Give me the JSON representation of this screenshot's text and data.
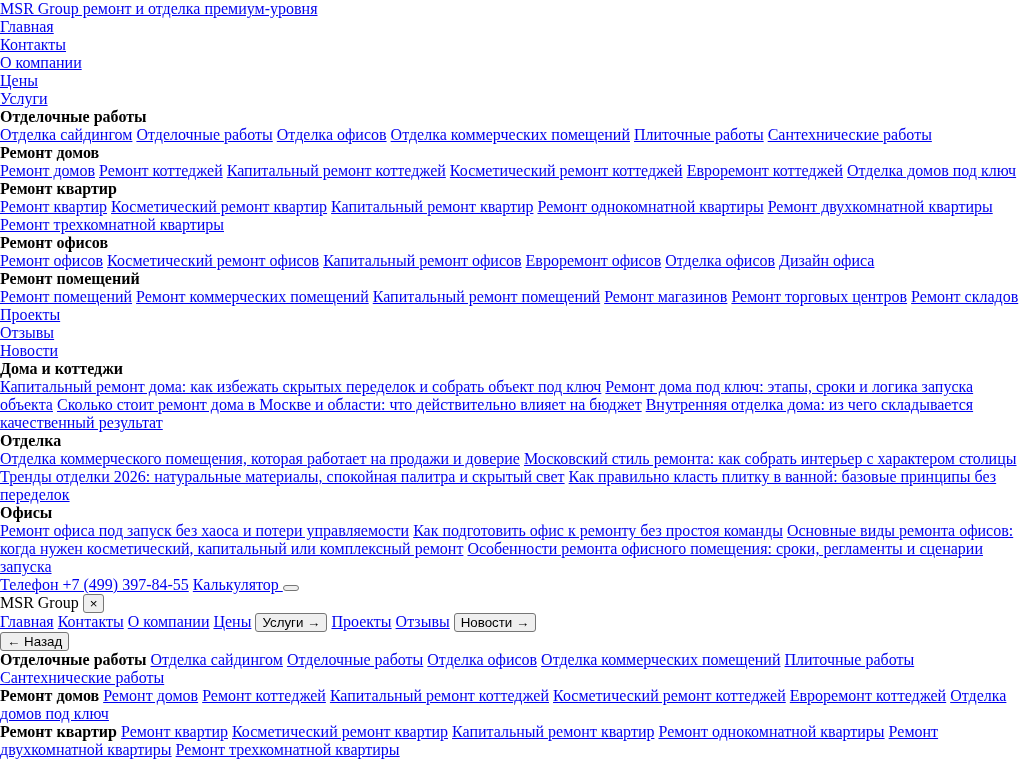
{
  "brand": "MSR Group ремонт и отделка премиум-уровня",
  "menu": [
    {
      "kind": "link",
      "label": "Главная"
    },
    {
      "kind": "link",
      "label": "Контакты"
    },
    {
      "kind": "link",
      "label": "О компании"
    },
    {
      "kind": "link",
      "label": "Цены"
    },
    {
      "kind": "link",
      "label": "Услуги"
    },
    {
      "kind": "group",
      "heading": "Отделочные работы",
      "links": [
        "Отделка сайдингом",
        "Отделочные работы",
        "Отделка офисов",
        "Отделка коммерческих помещений",
        "Плиточные работы",
        "Сантехнические работы"
      ]
    },
    {
      "kind": "group",
      "heading": "Ремонт домов",
      "links": [
        "Ремонт домов",
        "Ремонт коттеджей",
        "Капитальный ремонт коттеджей",
        "Косметический ремонт коттеджей",
        "Евроремонт коттеджей",
        "Отделка домов под ключ"
      ]
    },
    {
      "kind": "group",
      "heading": "Ремонт квартир",
      "links": [
        "Ремонт квартир",
        "Косметический ремонт квартир",
        "Капитальный ремонт квартир",
        "Ремонт однокомнатной квартиры",
        "Ремонт двухкомнатной квартиры",
        "Ремонт трехкомнатной квартиры"
      ]
    },
    {
      "kind": "group",
      "heading": "Ремонт офисов",
      "links": [
        "Ремонт офисов",
        "Косметический ремонт офисов",
        "Капитальный ремонт офисов",
        "Евроремонт офисов",
        "Отделка офисов",
        "Дизайн офиса"
      ]
    },
    {
      "kind": "group",
      "heading": "Ремонт помещений",
      "links": [
        "Ремонт помещений",
        "Ремонт коммерческих помещений",
        "Капитальный ремонт помещений",
        "Ремонт магазинов",
        "Ремонт торговых центров",
        "Ремонт складов"
      ]
    },
    {
      "kind": "link",
      "label": "Проекты"
    },
    {
      "kind": "link",
      "label": "Отзывы"
    },
    {
      "kind": "link",
      "label": "Новости"
    },
    {
      "kind": "group",
      "heading": "Дома и коттеджи",
      "links": [
        "Капитальный ремонт дома: как избежать скрытых переделок и собрать объект под ключ",
        [
          "Ремонт дома под ключ: этапы, сроки и логика запуска",
          "объекта"
        ],
        "Сколько стоит ремонт дома в Москве и области: что действительно влияет на бюджет",
        [
          "Внутренняя отделка дома: из чего складывается",
          "качественный результат"
        ]
      ]
    },
    {
      "kind": "group",
      "heading": "Отделка",
      "links": [
        "Отделка коммерческого помещения, которая работает на продажи и доверие",
        "Московский стиль ремонта: как собрать интерьер с характером столицы",
        "Тренды отделки 2026: натуральные материалы, спокойная палитра и скрытый свет",
        [
          "Как правильно класть плитку в ванной: базовые принципы без",
          "переделок"
        ]
      ]
    },
    {
      "kind": "group",
      "heading": "Офисы",
      "links": [
        "Ремонт офиса под запуск без хаоса и потери управляемости",
        "Как подготовить офис к ремонту без простоя команды",
        [
          "Основные виды ремонта офисов:",
          "когда нужен косметический, капитальный или комплексный ремонт"
        ],
        [
          "Особенности ремонта офисного помещения: сроки, регламенты и сценарии",
          "запуска"
        ]
      ]
    }
  ],
  "contacts": [
    "Телефон +7 (499) 397-84-55",
    "Калькулятор "
  ],
  "menu_open": true,
  "mobile_menu": {
    "title": "MSR Group",
    "close": "×",
    "nav": [
      {
        "kind": "link",
        "label": "Главная"
      },
      {
        "kind": "link",
        "label": "Контакты"
      },
      {
        "kind": "link",
        "label": "О компании"
      },
      {
        "kind": "link",
        "label": "Цены"
      },
      {
        "kind": "button",
        "label": "Услуги →"
      },
      {
        "kind": "link",
        "label": "Проекты"
      },
      {
        "kind": "link",
        "label": "Отзывы"
      },
      {
        "kind": "button",
        "label": "Новости →"
      }
    ],
    "back": "← Назад",
    "groups": [
      {
        "heading": "Отделочные работы",
        "links": [
          "Отделка сайдингом",
          "Отделочные работы",
          "Отделка офисов",
          "Отделка коммерческих помещений",
          "Плиточные работы",
          "Сантехнические работы"
        ]
      },
      {
        "heading": "Ремонт домов",
        "links": [
          "Ремонт домов",
          "Ремонт коттеджей",
          "Капитальный ремонт коттеджей",
          "Косметический ремонт коттеджей",
          "Евроремонт коттеджей",
          [
            "Отделка",
            "домов под ключ"
          ]
        ]
      },
      {
        "heading": "Ремонт квартир",
        "links": [
          "Ремонт квартир",
          "Косметический ремонт квартир",
          "Капитальный ремонт квартир",
          "Ремонт однокомнатной квартиры",
          [
            "Ремонт",
            "двухкомнатной квартиры"
          ],
          "Ремонт трехкомнатной квартиры"
        ]
      }
    ]
  }
}
